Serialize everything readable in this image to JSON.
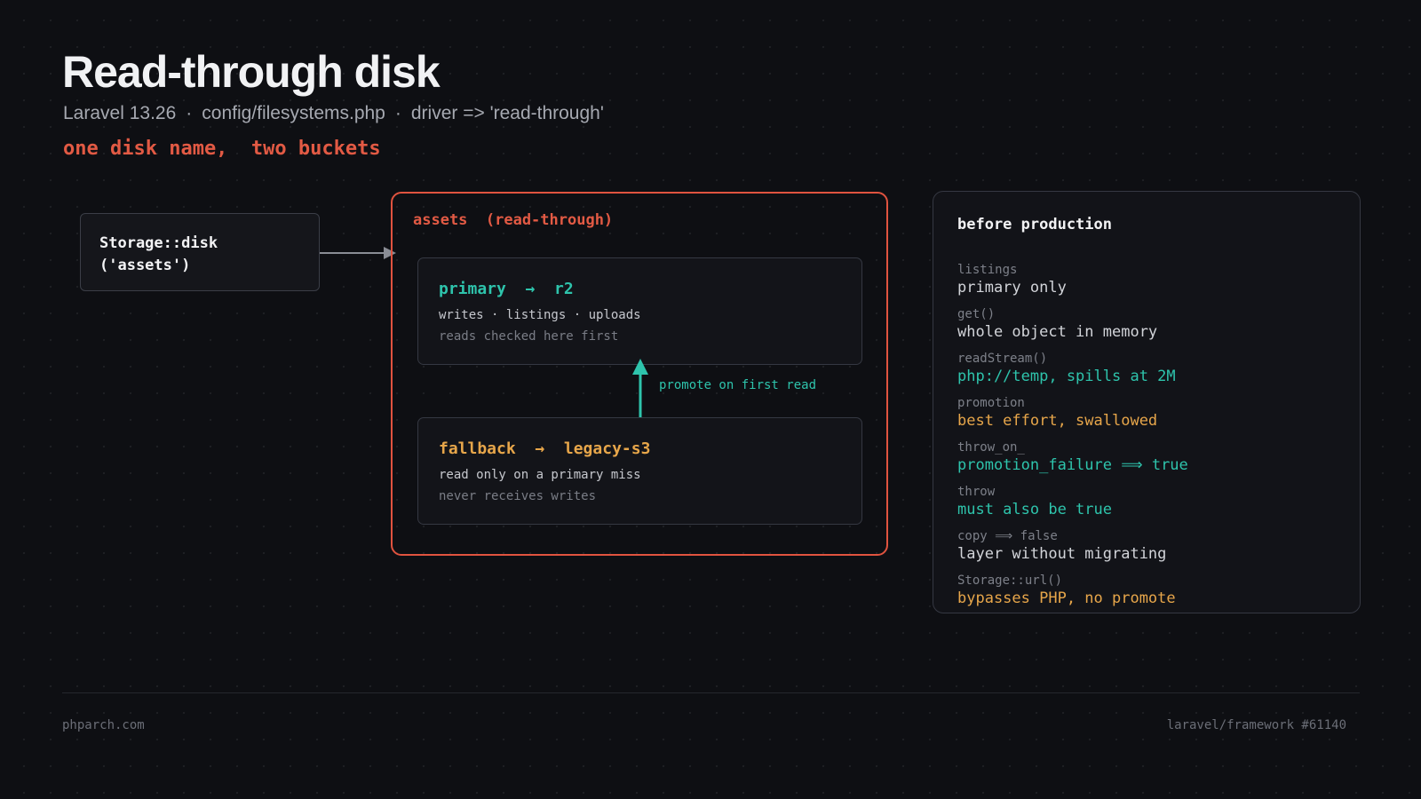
{
  "header": {
    "title": "Read-through disk",
    "subtitle": {
      "version": "Laravel 13.26",
      "config_file": "config/filesystems.php",
      "driver": "driver => 'read-through'",
      "separator": "·"
    },
    "tagline": "one disk name,  two buckets"
  },
  "caller": {
    "line1": "Storage::disk",
    "line2": "('assets')"
  },
  "disk": {
    "label": "assets  (read-through)",
    "primary": {
      "heading": "primary  →  r2",
      "line1": "writes · listings · uploads",
      "line2": "reads checked here first"
    },
    "fallback": {
      "heading": "fallback  →  legacy-s3",
      "line1": "read only on a primary miss",
      "line2": "never receives writes"
    },
    "promote_label": "promote on first read"
  },
  "checklist": {
    "title": "before production",
    "items": [
      {
        "key": "listings",
        "value": "primary only",
        "tone": "neutral"
      },
      {
        "key": "get()",
        "value": "whole object in memory",
        "tone": "neutral"
      },
      {
        "key": "readStream()",
        "value": "php://temp, spills at 2M",
        "tone": "teal"
      },
      {
        "key": "promotion",
        "value": "best effort, swallowed",
        "tone": "amber"
      },
      {
        "key": "throw_on_",
        "value": "promotion_failure ⟹ true",
        "tone": "teal"
      },
      {
        "key": "throw",
        "value": "must also be true",
        "tone": "teal"
      },
      {
        "key": "copy ⟹ false",
        "value": "layer without migrating",
        "tone": "neutral"
      },
      {
        "key": "Storage::url()",
        "value": "bypasses PHP, no promote",
        "tone": "amber"
      }
    ]
  },
  "footer": {
    "site": "phparch.com",
    "reference": "laravel/framework #61140"
  },
  "colors": {
    "accent_red": "#e0533f",
    "teal": "#2ec4ac",
    "amber": "#e7a64a",
    "neutral_text": "#d2d4d9",
    "background": "#0e0f13"
  }
}
